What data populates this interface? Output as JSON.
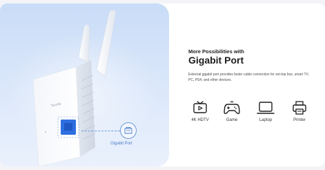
{
  "device": {
    "brand_mark": "Tenda",
    "callout_label": "Gigabit Port"
  },
  "content": {
    "subtitle": "More Possibilities with",
    "title": "Gigabit Port",
    "description": "External gigabit port provides faster cable connection for set-top box, smart TV, PC, PS4, and other devices."
  },
  "features": [
    {
      "label": "4K HDTV",
      "icon": "tv-icon"
    },
    {
      "label": "Game",
      "icon": "gamepad-icon"
    },
    {
      "label": "Laptop",
      "icon": "laptop-icon"
    },
    {
      "label": "Printer",
      "icon": "printer-icon"
    }
  ],
  "colors": {
    "panel_blue": "#c9dcf7",
    "accent_blue": "#4f7fc8",
    "port_blue": "#2d6fe0",
    "text_dark": "#1d1d1f"
  }
}
